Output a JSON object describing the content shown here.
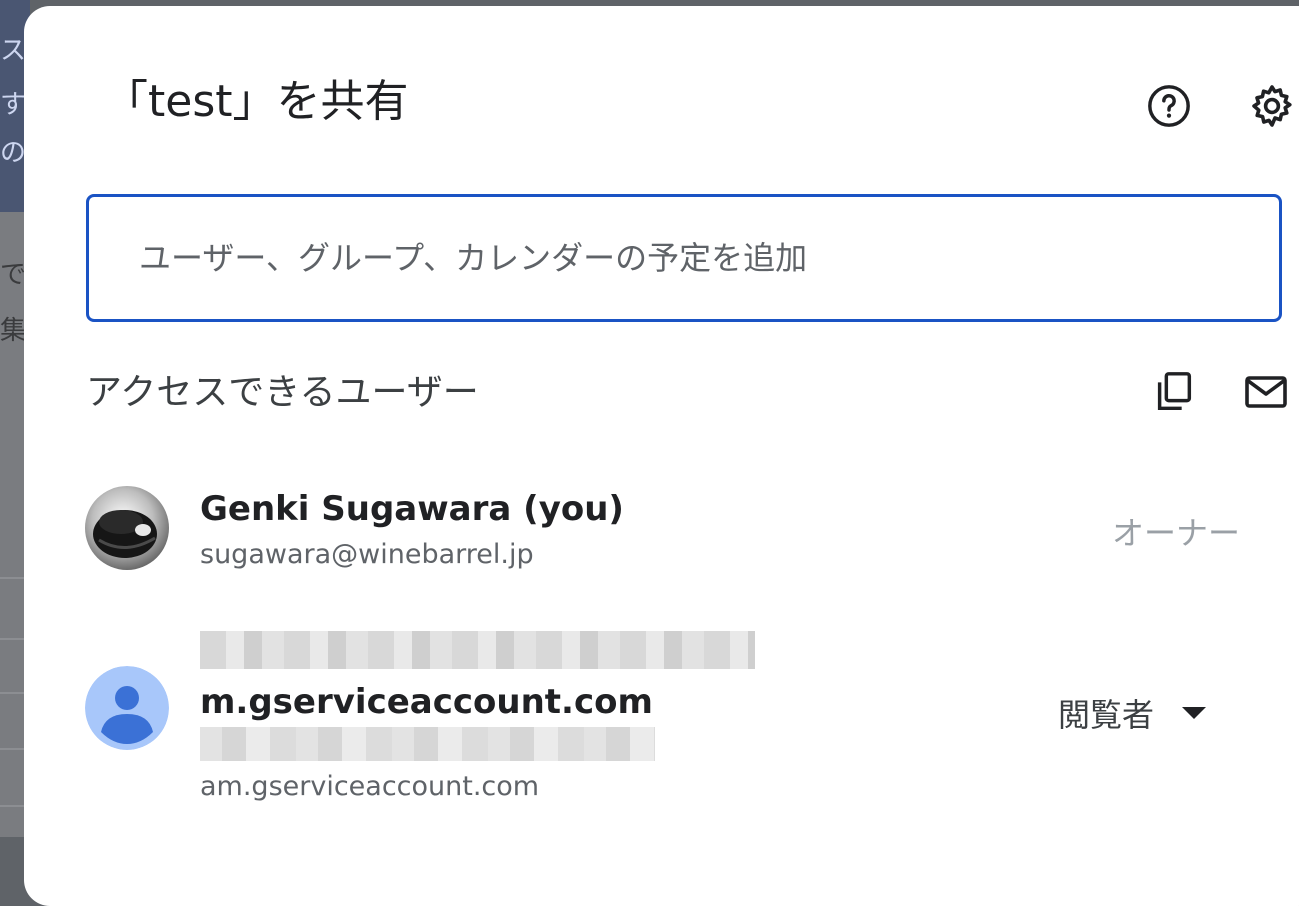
{
  "dialog": {
    "title": "「test」を共有",
    "help_icon": "help-circle-icon",
    "settings_icon": "gear-icon",
    "add_placeholder": "ユーザー、グループ、カレンダーの予定を追加"
  },
  "access": {
    "heading": "アクセスできるユーザー",
    "copy_icon": "copy-icon",
    "mail_icon": "mail-icon",
    "users": [
      {
        "name": "Genki Sugawara (you)",
        "email": "sugawara@winebarrel.jp",
        "role": "オーナー",
        "avatar": "photo-avatar"
      },
      {
        "name_suffix": "m.gserviceaccount.com",
        "email_suffix": "am.gserviceaccount.com",
        "role": "閲覧者",
        "avatar": "default-person-avatar"
      }
    ]
  },
  "background": {
    "chars": [
      "ス",
      "す",
      "の",
      "で",
      "集"
    ]
  },
  "colors": {
    "accent": "#1a53c4",
    "avatar_bg": "#a8c7fa",
    "avatar_fg": "#3b71d6"
  }
}
